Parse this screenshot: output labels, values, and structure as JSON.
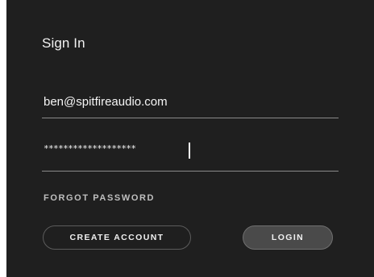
{
  "signin": {
    "title": "Sign In",
    "email_value": "ben@spitfireaudio.com",
    "password_masked": "*******************",
    "forgot_label": "FORGOT PASSWORD",
    "create_label": "CREATE ACCOUNT",
    "login_label": "LOGIN"
  },
  "colors": {
    "panel_bg": "#1f1f1f",
    "text": "#f2f2f2",
    "login_bg": "#4a4a4a"
  }
}
